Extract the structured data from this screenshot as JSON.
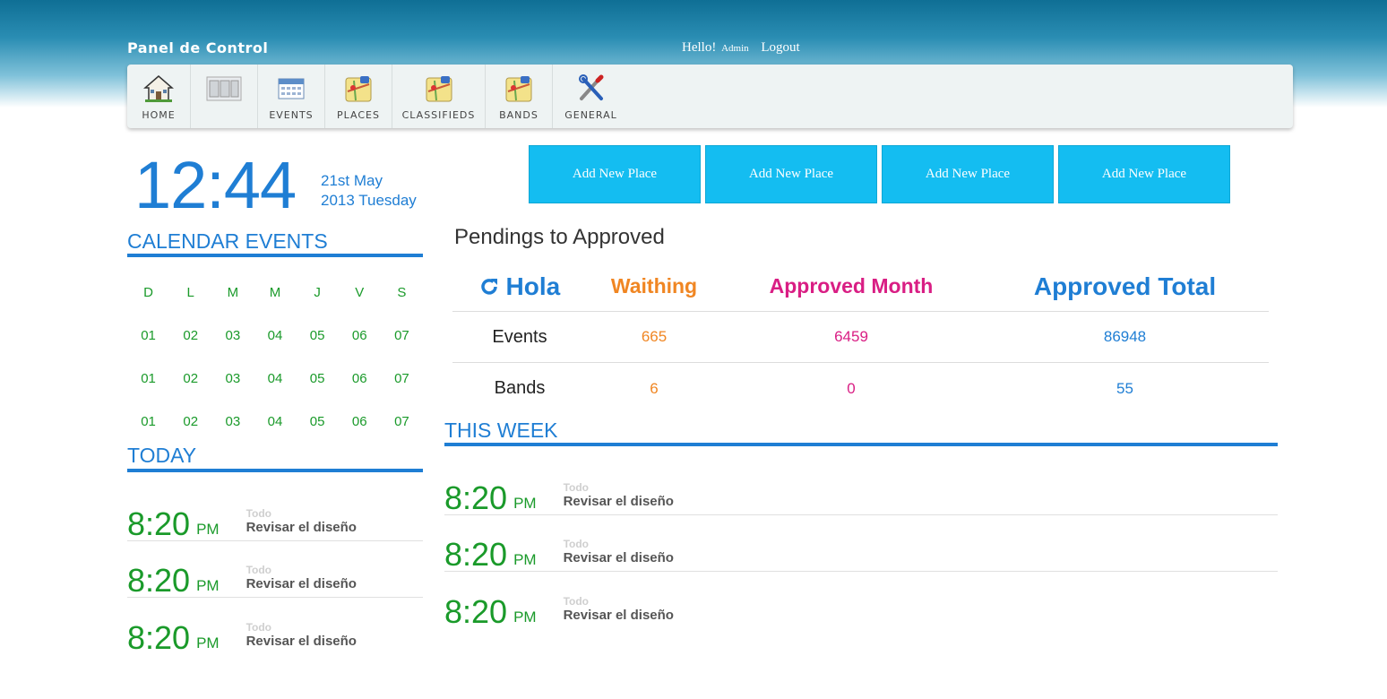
{
  "header": {
    "brand": "Panel de Control",
    "greeting": "Hello!",
    "user": "Admin",
    "logout": "Logout"
  },
  "nav": [
    {
      "label": "HOME",
      "icon": "house-icon"
    },
    {
      "label": "",
      "icon": "layout-icon"
    },
    {
      "label": "EVENTS",
      "icon": "calendar-icon"
    },
    {
      "label": "PLACES",
      "icon": "map-icon"
    },
    {
      "label": "CLASSIFIEDS",
      "icon": "map-icon"
    },
    {
      "label": "BANDS",
      "icon": "map-icon"
    },
    {
      "label": "GENERAL",
      "icon": "tools-icon"
    }
  ],
  "clock": {
    "time": "12:44",
    "date_line1": "21st May",
    "date_line2": "2013 Tuesday"
  },
  "buttons": [
    "Add New Place",
    "Add New Place",
    "Add New Place",
    "Add New Place"
  ],
  "calendar": {
    "title": "CALENDAR EVENTS",
    "days": [
      "D",
      "L",
      "M",
      "M",
      "J",
      "V",
      "S"
    ],
    "weeks": [
      [
        "01",
        "02",
        "03",
        "04",
        "05",
        "06",
        "07"
      ],
      [
        "01",
        "02",
        "03",
        "04",
        "05",
        "06",
        "07"
      ],
      [
        "01",
        "02",
        "03",
        "04",
        "05",
        "06",
        "07"
      ]
    ]
  },
  "today": {
    "title": "TODAY",
    "items": [
      {
        "time": "8:20",
        "ampm": "PM",
        "category": "Todo",
        "task": "Revisar el diseño"
      },
      {
        "time": "8:20",
        "ampm": "PM",
        "category": "Todo",
        "task": "Revisar el diseño"
      },
      {
        "time": "8:20",
        "ampm": "PM",
        "category": "Todo",
        "task": "Revisar el diseño"
      }
    ]
  },
  "pending": {
    "title": "Pendings to Approved",
    "headers": {
      "refresh": "Hola",
      "waiting": "Waithing",
      "month": "Approved Month",
      "total": "Approved Total"
    },
    "rows": [
      {
        "label": "Events",
        "waiting": "665",
        "month": "6459",
        "total": "86948"
      },
      {
        "label": "Bands",
        "waiting": "6",
        "month": "0",
        "total": "55"
      }
    ]
  },
  "week": {
    "title": "THIS WEEK",
    "items": [
      {
        "time": "8:20",
        "ampm": "PM",
        "category": "Todo",
        "task": "Revisar el diseño"
      },
      {
        "time": "8:20",
        "ampm": "PM",
        "category": "Todo",
        "task": "Revisar el diseño"
      },
      {
        "time": "8:20",
        "ampm": "PM",
        "category": "Todo",
        "task": "Revisar el diseño"
      }
    ]
  },
  "colors": {
    "accent_blue": "#1f7ed4",
    "button_cyan": "#14bdf1",
    "green": "#1a9a2a",
    "orange": "#f08623",
    "magenta": "#d91e84"
  }
}
